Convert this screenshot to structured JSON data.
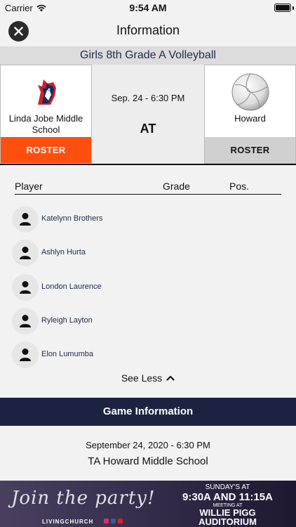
{
  "status_bar": {
    "carrier": "Carrier",
    "time": "9:54 AM"
  },
  "nav": {
    "title": "Information"
  },
  "game": {
    "title": "Girls 8th Grade A Volleyball",
    "home_team": {
      "name": "Linda Jobe Middle School",
      "roster_label": "ROSTER"
    },
    "away_team": {
      "name": "Howard",
      "roster_label": "ROSTER"
    },
    "date": "Sep. 24 - 6:30 PM",
    "at_label": "AT"
  },
  "roster": {
    "columns": {
      "player": "Player",
      "grade": "Grade",
      "pos": "Pos."
    },
    "players": [
      {
        "name": "Katelynn Brothers"
      },
      {
        "name": "Ashlyn Hurta"
      },
      {
        "name": "London Laurence"
      },
      {
        "name": "Ryleigh Layton"
      },
      {
        "name": "Elon Lumumba"
      }
    ],
    "see_less_label": "See Less"
  },
  "game_info": {
    "header": "Game Information",
    "datetime": "September 24, 2020 - 6:30 PM",
    "location": "TA Howard Middle School"
  },
  "ad": {
    "script_text": "Join the party!",
    "church": "LIVINGCHURCH",
    "line1": "SUNDAY'S AT",
    "line2": "9:30A AND 11:15A",
    "line3": "MEETING AT",
    "line4": "WILLIE PIGG",
    "line5": "AUDITORIUM"
  },
  "colors": {
    "accent_orange": "#ff4f0f",
    "navy": "#1b2340",
    "title_bar": "#dcdcdc"
  }
}
